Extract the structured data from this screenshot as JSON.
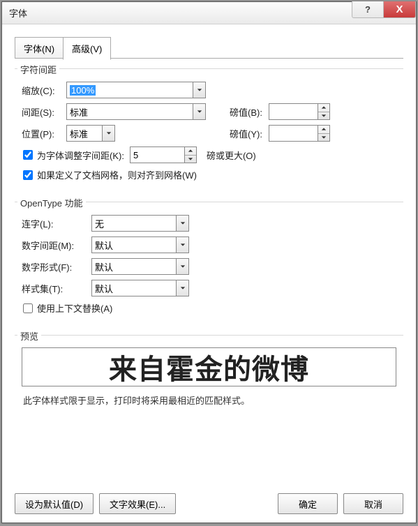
{
  "window": {
    "title": "字体",
    "help": "?",
    "close": "X"
  },
  "tabs": {
    "font": "字体(N)",
    "advanced": "高级(V)",
    "active": "advanced"
  },
  "spacing": {
    "group_title": "字符间距",
    "scale_label": "缩放(C):",
    "scale_value": "100%",
    "spacing_label": "间距(S):",
    "spacing_value": "标准",
    "pts1_label": "磅值(B):",
    "pts1_value": "",
    "pos_label": "位置(P):",
    "pos_value": "标准",
    "pts2_label": "磅值(Y):",
    "pts2_value": "",
    "kerning_chk": "为字体调整字间距(K):",
    "kerning_value": "5",
    "kerning_unit": "磅或更大(O)",
    "snap_chk": "如果定义了文档网格，则对齐到网格(W)"
  },
  "opentype": {
    "group_title": "OpenType 功能",
    "lig_label": "连字(L):",
    "lig_value": "无",
    "numspace_label": "数字间距(M):",
    "numspace_value": "默认",
    "numform_label": "数字形式(F):",
    "numform_value": "默认",
    "styleset_label": "样式集(T):",
    "styleset_value": "默认",
    "context_chk": "使用上下文替换(A)"
  },
  "preview": {
    "group_title": "预览",
    "text": "来自霍金的微博",
    "note": "此字体样式限于显示，打印时将采用最相近的匹配样式。"
  },
  "footer": {
    "defaults": "设为默认值(D)",
    "effects": "文字效果(E)...",
    "ok": "确定",
    "cancel": "取消"
  }
}
